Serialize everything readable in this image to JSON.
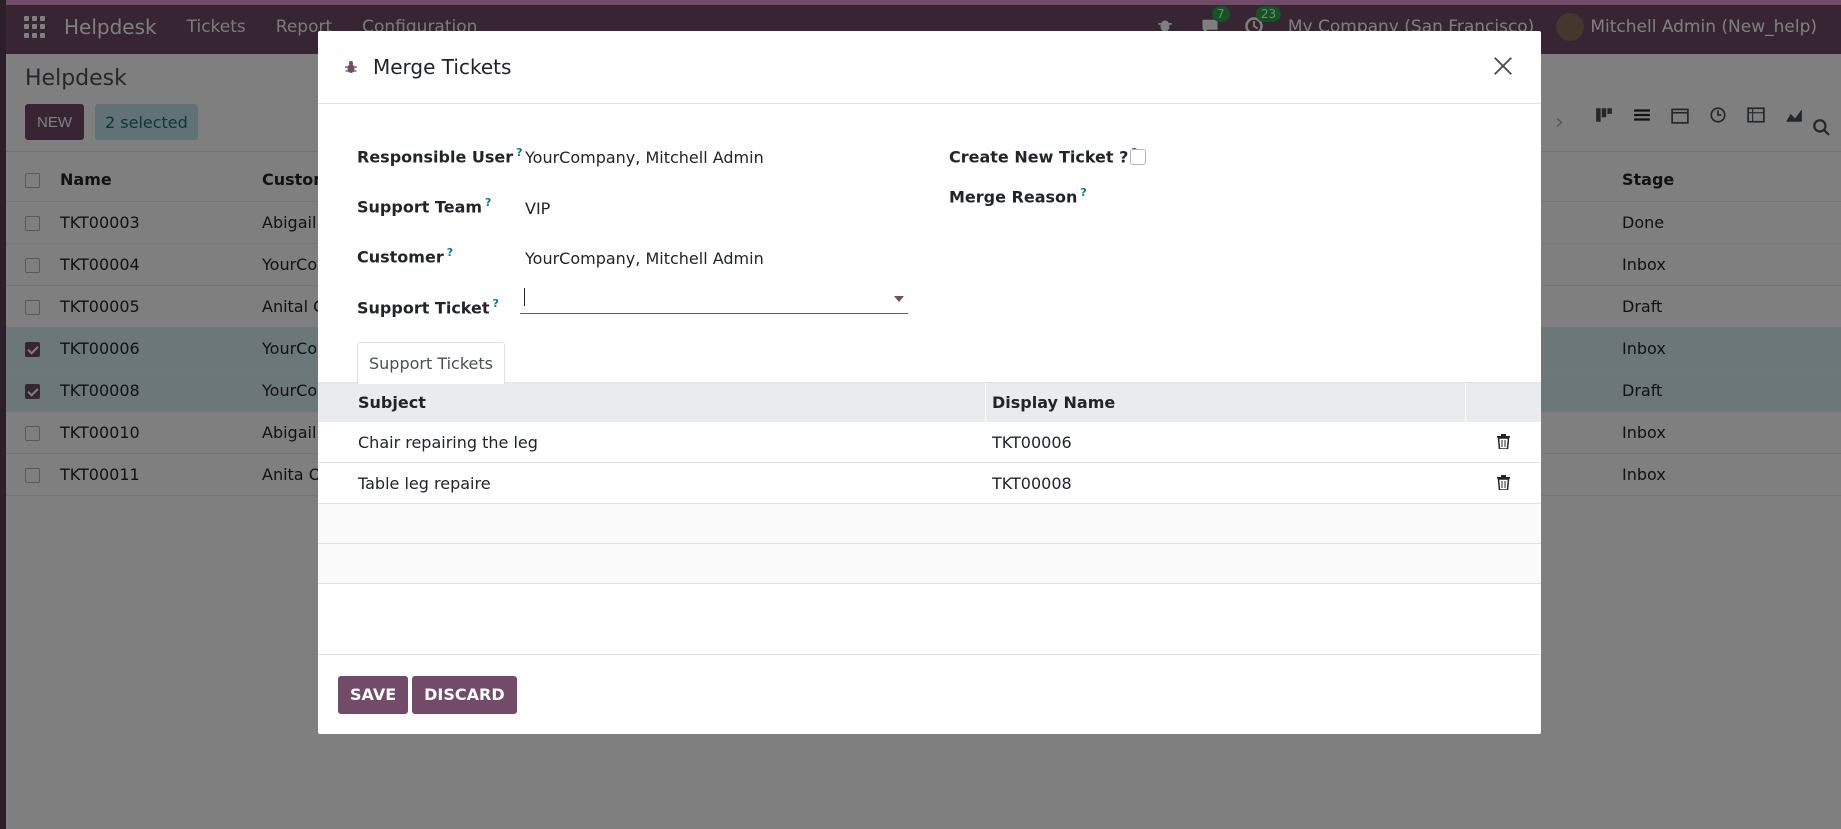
{
  "navbar": {
    "app_name": "Helpdesk",
    "menu": [
      "Tickets",
      "Report",
      "Configuration"
    ],
    "messages_count": "7",
    "activities_count": "23",
    "company": "My Company (San Francisco)",
    "user": "Mitchell Admin (New_help)"
  },
  "control_panel": {
    "breadcrumb": "Helpdesk",
    "new_label": "NEW",
    "selected_label": "2 selected"
  },
  "list": {
    "headers": {
      "name": "Name",
      "customer": "Custom",
      "stage": "Stage"
    },
    "rows": [
      {
        "name": "TKT00003",
        "customer": "Abigail I",
        "stage": "Done",
        "selected": false
      },
      {
        "name": "TKT00004",
        "customer": "YourCor",
        "stage": "Inbox",
        "selected": false
      },
      {
        "name": "TKT00005",
        "customer": "Anital O",
        "stage": "Draft",
        "selected": false
      },
      {
        "name": "TKT00006",
        "customer": "YourCor",
        "stage": "Inbox",
        "selected": true
      },
      {
        "name": "TKT00008",
        "customer": "YourCor",
        "stage": "Draft",
        "selected": true
      },
      {
        "name": "TKT00010",
        "customer": "Abigail I",
        "stage": "Inbox",
        "selected": false
      },
      {
        "name": "TKT00011",
        "customer": "Anita O",
        "stage": "Inbox",
        "selected": false
      }
    ]
  },
  "modal": {
    "title": "Merge Tickets",
    "fields": {
      "responsible_user": {
        "label": "Responsible User",
        "value": "YourCompany, Mitchell Admin"
      },
      "support_team": {
        "label": "Support Team",
        "value": "VIP"
      },
      "customer": {
        "label": "Customer",
        "value": "YourCompany, Mitchell Admin"
      },
      "support_ticket": {
        "label": "Support Ticket",
        "value": ""
      },
      "create_new_ticket": {
        "label": "Create New Ticket ?",
        "checked": false
      },
      "merge_reason": {
        "label": "Merge Reason"
      }
    },
    "help_marker": "?",
    "tab_label": "Support Tickets",
    "table": {
      "headers": {
        "subject": "Subject",
        "display_name": "Display Name"
      },
      "rows": [
        {
          "subject": "Chair repairing the leg",
          "display_name": "TKT00006"
        },
        {
          "subject": "Table leg repaire",
          "display_name": "TKT00008"
        }
      ]
    },
    "save_label": "SAVE",
    "discard_label": "DISCARD"
  },
  "colors": {
    "brand": "#714B67",
    "selected_row": "#d7eef0",
    "help": "#017e84"
  }
}
